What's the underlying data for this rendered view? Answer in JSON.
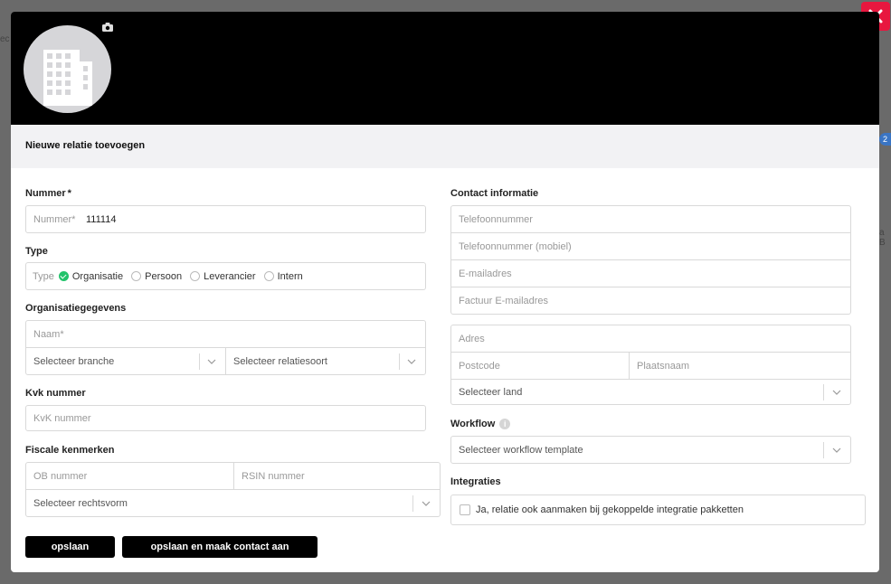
{
  "background": {
    "fragment_left": "ec",
    "fragment_right": "a B",
    "badge": "2"
  },
  "modal": {
    "title": "Nieuwe relatie toevoegen",
    "sections": {
      "nummer": {
        "label": "Nummer",
        "required_mark": "*",
        "placeholder": "Nummer*",
        "value": "111114"
      },
      "type": {
        "label": "Type",
        "prefix": "Type",
        "options": [
          {
            "label": "Organisatie",
            "selected": true
          },
          {
            "label": "Persoon",
            "selected": false
          },
          {
            "label": "Leverancier",
            "selected": false
          },
          {
            "label": "Intern",
            "selected": false
          }
        ]
      },
      "organisatie": {
        "label": "Organisatiegegevens",
        "naam_placeholder": "Naam*",
        "branche_placeholder": "Selecteer branche",
        "relatiesoort_placeholder": "Selecteer relatiesoort"
      },
      "kvk": {
        "label": "Kvk nummer",
        "placeholder": "KvK nummer"
      },
      "fiscaal": {
        "label": "Fiscale kenmerken",
        "ob_placeholder": "OB nummer",
        "rsin_placeholder": "RSIN nummer",
        "rechtsvorm_placeholder": "Selecteer rechtsvorm"
      },
      "contact": {
        "label": "Contact informatie",
        "telefoon": "Telefoonnummer",
        "mobiel": "Telefoonnummer (mobiel)",
        "email": "E-mailadres",
        "factuur_email": "Factuur E-mailadres"
      },
      "adres": {
        "adres": "Adres",
        "postcode": "Postcode",
        "plaatsnaam": "Plaatsnaam",
        "land": "Selecteer land"
      },
      "workflow": {
        "label": "Workflow",
        "info_icon": "i",
        "placeholder": "Selecteer workflow template"
      },
      "integraties": {
        "label": "Integraties",
        "checkbox_label": "Ja, relatie ook aanmaken bij gekoppelde integratie pakketten"
      }
    },
    "buttons": {
      "save": "opslaan",
      "save_contact": "opslaan en maak contact aan"
    }
  },
  "colors": {
    "accent_close": "#e8173f",
    "check_green": "#22c36b",
    "header": "#000000"
  }
}
